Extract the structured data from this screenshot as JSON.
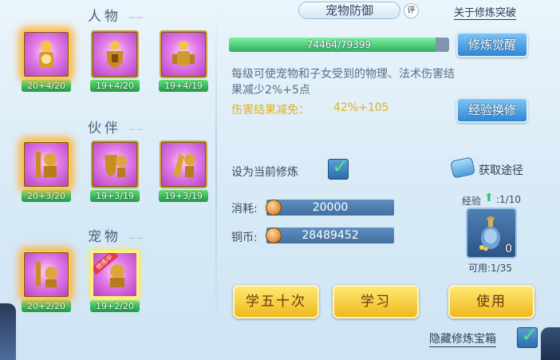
{
  "left": {
    "sections": [
      {
        "title": "人物",
        "cards": [
          {
            "level": "20+4/20",
            "glow": true,
            "selected": false
          },
          {
            "level": "19+4/20",
            "glow": false,
            "selected": false
          },
          {
            "level": "19+4/19",
            "glow": false,
            "selected": false
          }
        ]
      },
      {
        "title": "伙伴",
        "cards": [
          {
            "level": "20+3/20",
            "glow": true,
            "selected": false
          },
          {
            "level": "19+3/19",
            "glow": false,
            "selected": false
          },
          {
            "level": "19+3/19",
            "glow": false,
            "selected": false
          }
        ]
      },
      {
        "title": "宠物",
        "cards": [
          {
            "level": "20+2/20",
            "glow": true,
            "selected": false
          },
          {
            "level": "19+2/20",
            "glow": false,
            "selected": true,
            "badge": "修炼中"
          }
        ]
      }
    ]
  },
  "header": {
    "title": "宠物防御",
    "rate_icon": "评",
    "about_link": "关于修炼突破"
  },
  "progress": {
    "text": "74464/79399",
    "current": 74464,
    "max": 79399
  },
  "buttons": {
    "awaken": "修炼觉醒",
    "exchange": "经验换修",
    "learn50": "学五十次",
    "learn": "学习",
    "use": "使用"
  },
  "description": "每级可使宠物和子女受到的物理、法术伤害结果减少2%+5点",
  "damage": {
    "label": "伤害结果减免：",
    "value": "42%+105"
  },
  "current_training": {
    "label": "设为当前修炼",
    "checked": true
  },
  "obtain": {
    "label": "获取途径"
  },
  "cost": {
    "label": "消耗:",
    "value": "20000"
  },
  "copper": {
    "label": "铜币:",
    "value": "28489452"
  },
  "exp": {
    "label": "经验",
    "value": ":1/10"
  },
  "item": {
    "count": "0",
    "usable": "可用:1/35"
  },
  "hide": {
    "label": "隐藏修炼宝箱",
    "checked": true
  },
  "colors": {
    "accent_gold": "#e0b21c",
    "button_blue": "#2e86d4",
    "progress_green": "#2fae62"
  }
}
